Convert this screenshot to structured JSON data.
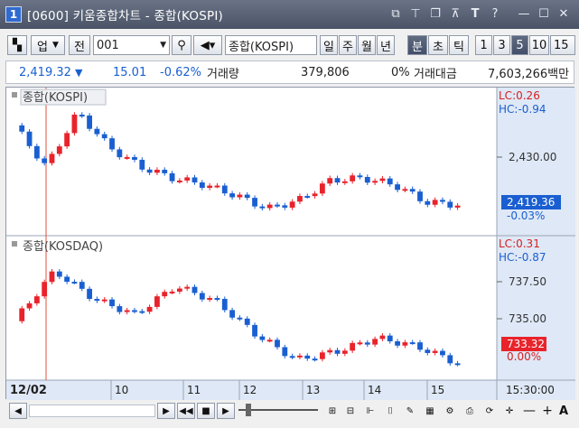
{
  "window": {
    "number": "1",
    "title": "[0600] 키움종합차트 - 종합(KOSPI)",
    "tools": [
      "restore-icon",
      "pin-icon",
      "copy-icon",
      "tile-icon",
      "T",
      "?",
      "minimize",
      "maximize",
      "close"
    ]
  },
  "toolbar": {
    "market": "업",
    "all": "전",
    "code": "001",
    "name": "종합(KOSPI)",
    "periods": [
      "일",
      "주",
      "월",
      "년"
    ],
    "period_types": [
      "분",
      "초",
      "틱"
    ],
    "intervals": [
      "1",
      "3",
      "5",
      "10",
      "15"
    ],
    "active_period_type": "분",
    "active_interval": "5"
  },
  "quote": {
    "price": "2,419.32",
    "change": "15.01",
    "pct": "-0.62%",
    "vol_label": "거래량",
    "vol": "379,806",
    "vol_pct": "0%",
    "amt_label": "거래대금",
    "amt": "7,603,266백만"
  },
  "panes": [
    {
      "label": "종합(KOSPI)",
      "lc": "LC:0.26",
      "hc": "HC:-0.94",
      "tick": "2,430.00",
      "last_price": "2,419.36",
      "last_pct": "-0.03%"
    },
    {
      "label": "종합(KOSDAQ)",
      "lc": "LC:0.31",
      "hc": "HC:-0.87",
      "ticks": [
        "737.50",
        "735.00"
      ],
      "last_price": "733.32",
      "last_pct": "0.00%"
    }
  ],
  "xaxis": {
    "labels": [
      "12/02",
      "10",
      "11",
      "12",
      "13",
      "14",
      "15"
    ],
    "time": "15:30:00"
  },
  "colors": {
    "up": "#e8232b",
    "down": "#1a5fd1",
    "axis_bg": "#dfe8f6",
    "last_kospi": "#1a5fd1",
    "last_kosdaq": "#e8232b"
  },
  "chart_data": [
    {
      "type": "candlestick",
      "title": "종합(KOSPI)",
      "x": [
        "12/02 09:00",
        "10",
        "11",
        "12",
        "13",
        "14",
        "15"
      ],
      "close": [
        2437.5,
        2428.0,
        2440.5,
        2432.5,
        2428.0,
        2425.5,
        2424.0,
        2421.5,
        2418.5,
        2420.5,
        2425.0,
        2425.5,
        2424.0,
        2420.0,
        2419.4
      ],
      "ylim_note": "2,430.00 tick"
    },
    {
      "type": "candlestick",
      "title": "종합(KOSDAQ)",
      "close": [
        735.8,
        738.8,
        737.1,
        736.2,
        737.9,
        737.0,
        735.0,
        733.5,
        734.0,
        734.8,
        734.3,
        733.3
      ],
      "ylim_note": "737.50 / 735.00 ticks"
    }
  ]
}
